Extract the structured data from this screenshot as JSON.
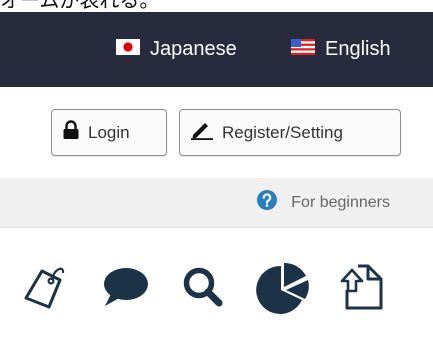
{
  "caption": "オームが表れる。",
  "header": {
    "languages": [
      {
        "label": "Japanese",
        "icon": "japan-flag-icon"
      },
      {
        "label": "English",
        "icon": "us-flag-icon"
      }
    ]
  },
  "auth": {
    "login_label": "Login",
    "register_label": "Register/Setting"
  },
  "help": {
    "label": "For beginners",
    "icon": "question-circle-icon"
  },
  "toolbar": {
    "icons": [
      "tag-icon",
      "comment-icon",
      "search-icon",
      "pie-chart-icon",
      "export-icon"
    ]
  },
  "colors": {
    "header_bg": "#262c3d",
    "icon_dark": "#1c3347",
    "help_icon": "#2a7fbf",
    "japan_red": "#e00000"
  }
}
